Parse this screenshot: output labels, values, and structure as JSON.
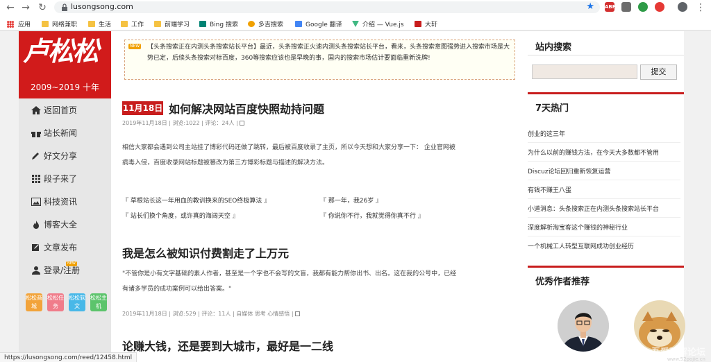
{
  "browser": {
    "url": "lusongsong.com",
    "status_url": "https://lusongsong.com/reed/12458.html",
    "bookmarks": [
      {
        "label": "应用"
      },
      {
        "label": "网络兼职"
      },
      {
        "label": "生活"
      },
      {
        "label": "工作"
      },
      {
        "label": "前端学习"
      },
      {
        "label": "Bing 搜索"
      },
      {
        "label": "多吉搜索"
      },
      {
        "label": "Google 翻译"
      },
      {
        "label": "介绍 — Vue.js"
      },
      {
        "label": "大轩"
      }
    ],
    "extensions": [
      "ABP"
    ]
  },
  "logo": {
    "text": "卢松松",
    "years": "2009~2019 十年"
  },
  "nav": {
    "items": [
      {
        "label": "返回首页"
      },
      {
        "label": "站长新闻"
      },
      {
        "label": "好文分享"
      },
      {
        "label": "段子来了"
      },
      {
        "label": "科技资讯"
      },
      {
        "label": "博客大全"
      },
      {
        "label": "文章发布"
      },
      {
        "label": "登录/注册"
      }
    ],
    "new_badge": "NEW",
    "tags": [
      {
        "label": "松松商城",
        "color": "#f2a33a"
      },
      {
        "label": "松松任务",
        "color": "#f07c8a"
      },
      {
        "label": "松松软文",
        "color": "#48b8e8"
      },
      {
        "label": "松松主机",
        "color": "#5cc46c"
      }
    ]
  },
  "notice": {
    "badge": "NEW",
    "text": "【头条搜索正在内测头条搜索站长平台】最近，头条搜索正火速内测头条搜索站长平台，看来，头条搜索意图强势进入搜索市场是大势已定，后续头条搜索对标百度，360等搜索应该也是早晚的事，国内的搜索市场估计要面临重新洗牌!"
  },
  "posts": [
    {
      "date": "11月18日",
      "title": "如何解决网站百度快照劫持问题",
      "meta": "2019年11月18日 | 浏览:1022 | 评论：24人 |",
      "excerpt_line1": "相信大家都会遇到公司主站挂了博彩代码还做了跳转，最后被百度收录了主页，所以今天想和大家分享一下：  企业官网被",
      "excerpt_line2": "病毒入侵，百度收录网站标题被篡改为第三方博彩标题与描述的解决方法。"
    },
    {
      "title": "我是怎么被知识付费割走了上万元",
      "excerpt_line1": "\"不管你是小有文字基础的素人作者，甚至是一个字也不会写的文盲，我都有能力帮你出书、出名。这在我的公号中，已经",
      "excerpt_line2": "有诸多学员的成功案例可以给出答案。\"",
      "meta": "2019年11月18日 | 浏览:529 | 评论：11人 | 自媒体 思考 心情感悟 |"
    },
    {
      "title": "论赚大钱，还是要到大城市，最好是一二线"
    }
  ],
  "related": [
    "『 草根站长这一年用血的教训换来的SEO终极算法 』",
    "『 那一年，我26岁 』",
    "『 站长们换个角度，或许真的海阔天空 』",
    "『 你说你不行，我就觉得你真不行 』"
  ],
  "sidebar": {
    "search_title": "站内搜索",
    "search_button": "提交",
    "hot_title": "7天热门",
    "hot_items": [
      "创业的这三年",
      "为什么以前的赚钱方法，在今天大多数都不管用",
      "Discuz论坛回归重新恢复运营",
      "有钱不赚王八蛋",
      "小道消息：头条搜索正在内测头条搜索站长平台",
      "深度解析淘宝客这个赚钱的神秘行业",
      "一个机械工人转型互联网成功创业经历"
    ],
    "authors_title": "优秀作者推荐"
  },
  "watermark": {
    "text": "吾爱破解论坛",
    "sub": "www.52pojie.cn"
  },
  "colors": {
    "brand_red": "#c81d1d",
    "logo_red": "#d11b1b"
  }
}
